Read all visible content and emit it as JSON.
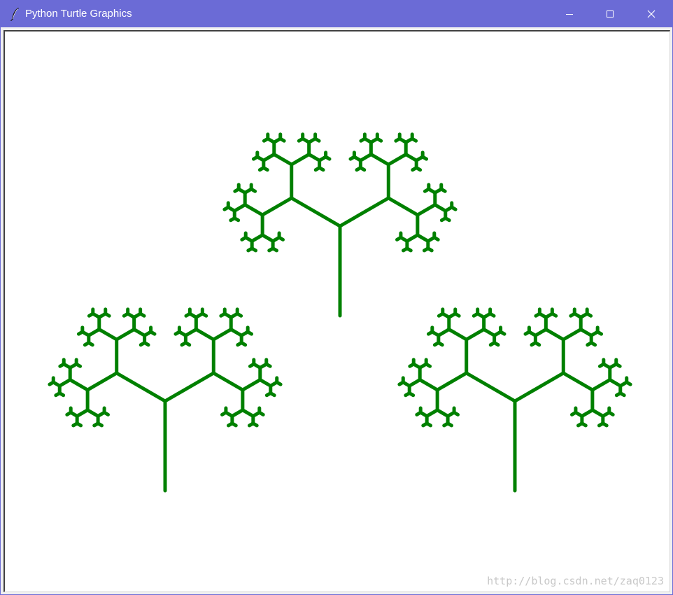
{
  "window": {
    "title": "Python Turtle Graphics",
    "title_bar_color": "#6b6bd6",
    "app_icon": "feather-icon",
    "controls": {
      "minimize_icon": "minimize-icon",
      "maximize_icon": "maximize-icon",
      "close_icon": "close-icon"
    }
  },
  "canvas": {
    "background": "#ffffff",
    "drawing": {
      "type": "fractal-tree",
      "count": 3,
      "pen_color": "#008000",
      "recursion_depth": 6,
      "branch_angle_deg": 60
    },
    "watermark": "http://blog.csdn.net/zaq0123"
  }
}
